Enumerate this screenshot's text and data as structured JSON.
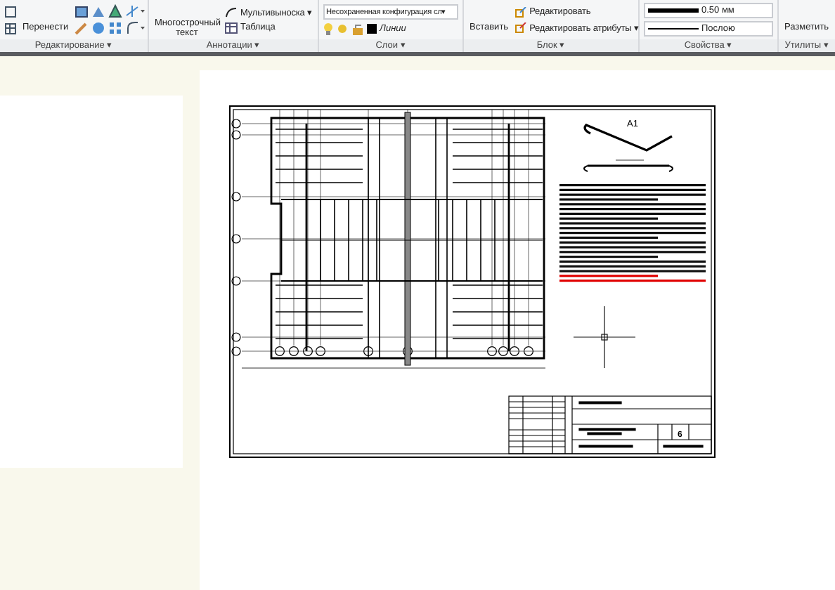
{
  "ribbon": {
    "editing": {
      "label": "Редактирование ▾",
      "move": "Перенести"
    },
    "annotation": {
      "label": "Аннотации ▾",
      "mtext": "Многострочный текст",
      "leader": "Мультивыноска ▾",
      "table": "Таблица"
    },
    "layers": {
      "label": "Слои ▾",
      "state": "Несохраненная конфигурация сл▾",
      "layer": "Линии"
    },
    "block": {
      "label": "Блок ▾",
      "insert": "Вставить",
      "edit": "Редактировать",
      "edit_attrs": "Редактировать атрибуты ▾"
    },
    "properties": {
      "label": "Свойства ▾",
      "lineweight": "0.50 мм",
      "linetype": "Послою"
    },
    "utilities": {
      "label": "Утилиты ▾",
      "measure": "Разметить"
    }
  },
  "sheet": {
    "detail_title": "A1",
    "sheet_number": "6"
  }
}
